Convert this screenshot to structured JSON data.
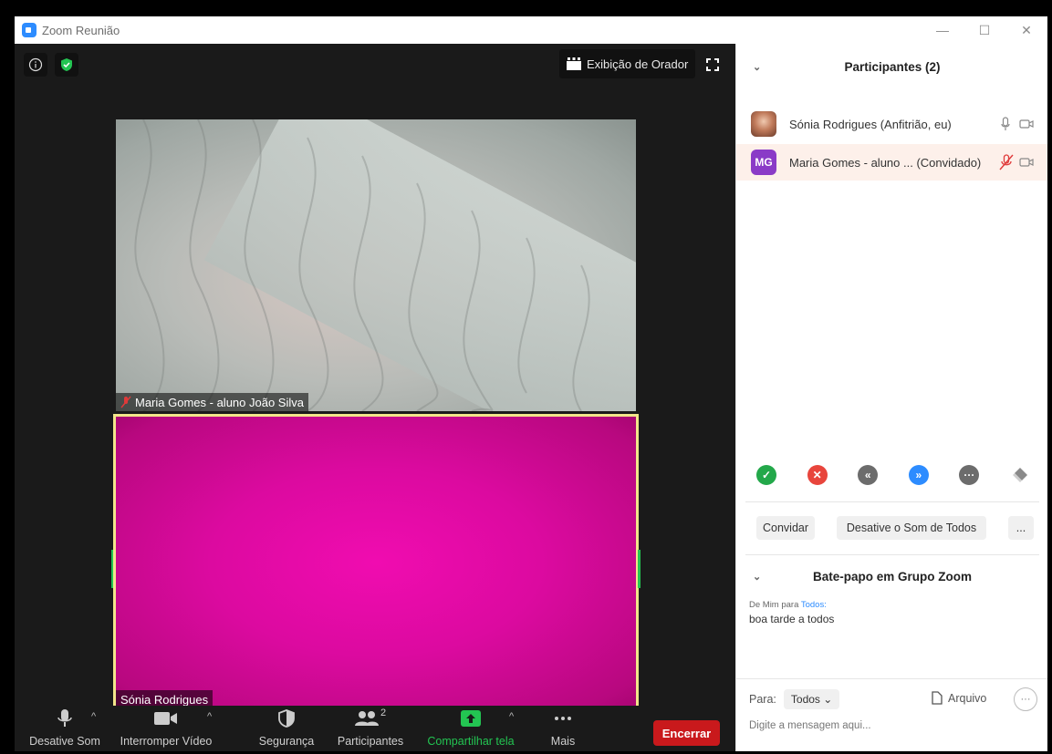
{
  "window": {
    "title": "Zoom Reunião",
    "controls": [
      "—",
      "☐",
      "✕"
    ]
  },
  "video": {
    "speaker_view_label": "Exibição de Orador",
    "tiles": [
      {
        "label": "Maria Gomes - aluno João Silva",
        "muted": true
      },
      {
        "label": "Sónia Rodrigues",
        "muted": false
      }
    ]
  },
  "toolbar": {
    "mute_label": "Desative Som",
    "video_label": "Interromper Vídeo",
    "security_label": "Segurança",
    "participants_label": "Participantes",
    "participants_count": "2",
    "share_label": "Compartilhar tela",
    "more_label": "Mais",
    "end_label": "Encerrar"
  },
  "panel": {
    "title": "Participantes (2)",
    "participants": [
      {
        "name": "Sónia Rodrigues (Anfitrião, eu)",
        "initials": ""
      },
      {
        "name": "Maria Gomes - aluno ... (Convidado)",
        "initials": "MG"
      }
    ],
    "invite_label": "Convidar",
    "mute_all_label": "Desative o Som de Todos",
    "more_label": "..."
  },
  "chat": {
    "title": "Bate-papo em Grupo Zoom",
    "from": "De Mim para",
    "to": "Todos:",
    "message": "boa tarde a todos",
    "to_label": "Para:",
    "to_value": "Todos",
    "file_label": "Arquivo",
    "placeholder": "Digite a mensagem aqui..."
  },
  "colors": {
    "accent": "#2d8cff",
    "end": "#c9191c",
    "share": "#23c552",
    "active_border": "#f2e58a"
  }
}
